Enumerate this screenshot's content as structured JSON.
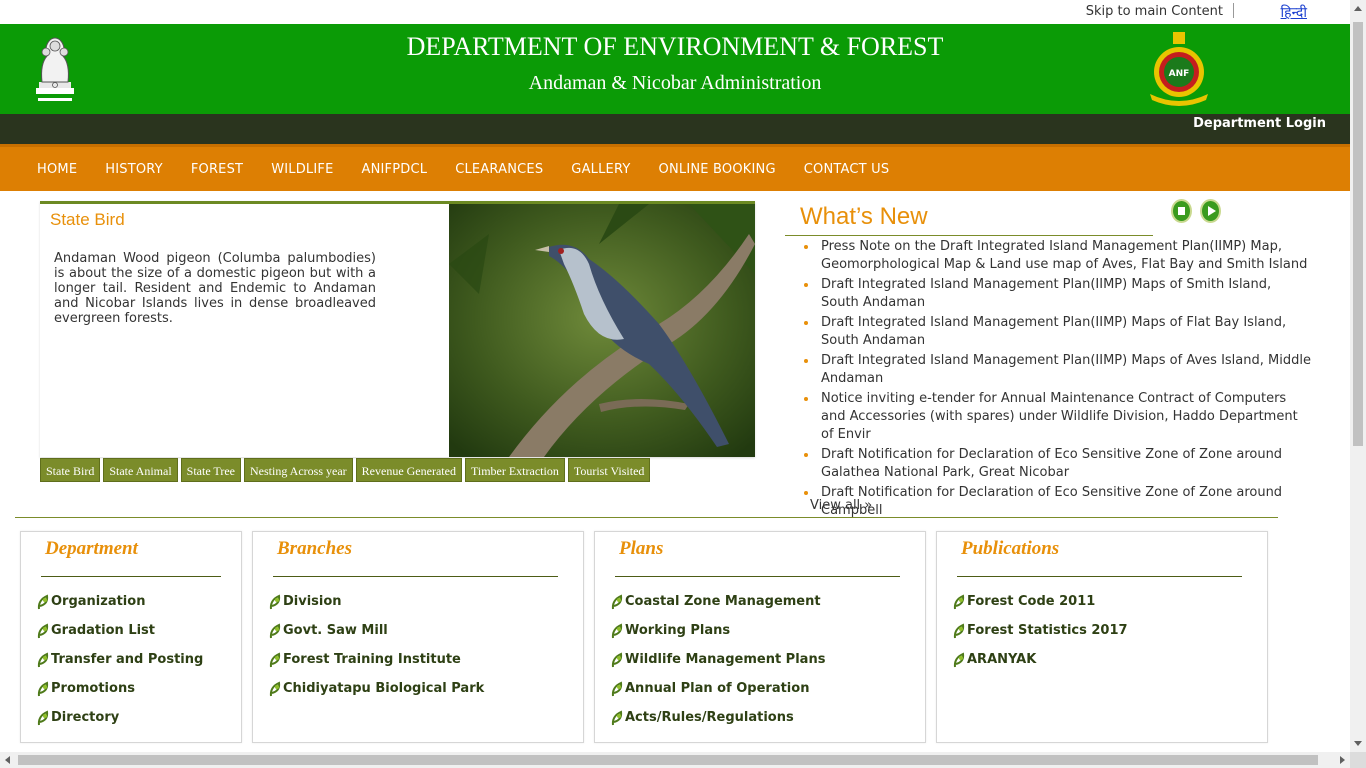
{
  "topbar": {
    "skip": "Skip to main Content",
    "hindi": "हिन्दी"
  },
  "header": {
    "title": "DEPARTMENT OF ENVIRONMENT & FOREST",
    "subtitle": "Andaman & Nicobar Administration",
    "login": "Department Login"
  },
  "colors": {
    "header_green": "#0b9b06",
    "nav_orange": "#dd7f03",
    "accent_orange": "#e8900a",
    "olive": "#7b8c2a"
  },
  "nav": [
    "HOME",
    "HISTORY",
    "FOREST",
    "WILDLIFE",
    "ANIFPDCL",
    "CLEARANCES",
    "GALLERY",
    "ONLINE BOOKING",
    "CONTACT US"
  ],
  "state": {
    "title": "State Bird",
    "description": "Andaman Wood pigeon (Columba palumbodies) is about the size of a domestic pigeon but with a longer tail. Resident and Endemic to Andaman and Nicobar Islands lives in dense broadleaved evergreen forests.",
    "tabs": [
      "State Bird",
      "State Animal",
      "State Tree",
      "Nesting Across year",
      "Revenue Generated",
      "Timber Extraction",
      "Tourist Visited"
    ]
  },
  "whats_new": {
    "title": "What’s New",
    "items": [
      "Press Note on the Draft Integrated Island Management Plan(IIMP) Map, Geomorphological Map & Land use map of Aves, Flat Bay and Smith Island",
      "Draft Integrated Island Management Plan(IIMP) Maps of Smith Island, South Andaman",
      "Draft Integrated Island Management Plan(IIMP) Maps of Flat Bay Island, South Andaman",
      "Draft Integrated Island Management Plan(IIMP) Maps of Aves Island, Middle Andaman",
      "Notice inviting e-tender for Annual Maintenance Contract of Computers and Accessories (with spares) under Wildlife Division, Haddo Department of Envir",
      "Draft Notification for Declaration of Eco Sensitive Zone of Zone around Galathea National Park, Great Nicobar",
      "Draft Notification for Declaration of Eco Sensitive Zone of Zone around Campbell"
    ],
    "view_all": "View all »"
  },
  "boxes": {
    "department": {
      "title": "Department",
      "items": [
        "Organization",
        "Gradation List",
        "Transfer and Posting",
        "Promotions",
        "Directory"
      ]
    },
    "branches": {
      "title": "Branches",
      "items": [
        "Division",
        "Govt. Saw Mill",
        "Forest Training Institute",
        "Chidiyatapu Biological Park"
      ]
    },
    "plans": {
      "title": "Plans",
      "items": [
        "Coastal Zone Management",
        "Working Plans",
        "Wildlife Management Plans",
        "Annual Plan of Operation",
        "Acts/Rules/Regulations"
      ]
    },
    "publications": {
      "title": "Publications",
      "items": [
        "Forest Code 2011",
        "Forest Statistics 2017",
        "ARANYAK"
      ]
    }
  }
}
